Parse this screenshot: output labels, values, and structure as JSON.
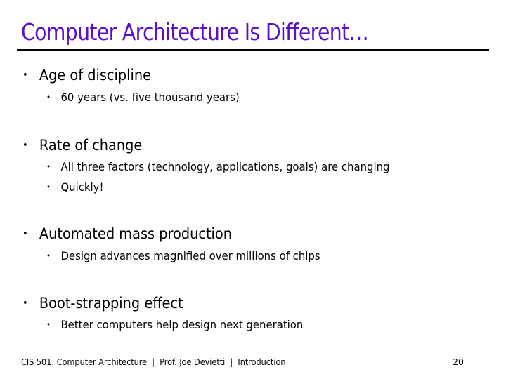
{
  "slide": {
    "title": "Computer Architecture Is Different…",
    "bullets": [
      {
        "text": "Age of discipline",
        "sub": [
          "60 years (vs. five thousand years)"
        ]
      },
      {
        "text": "Rate of change",
        "sub": [
          "All three factors (technology, applications, goals) are changing",
          "Quickly!"
        ]
      },
      {
        "text": "Automated mass production",
        "sub": [
          "Design advances magnified over millions of chips"
        ]
      },
      {
        "text": "Boot-strapping effect",
        "sub": [
          "Better computers help design next generation"
        ]
      }
    ]
  },
  "footer": {
    "text": "CIS 501: Computer Architecture  |  Prof. Joe Devietti  |  Introduction",
    "page_number": "20"
  },
  "bullet_glyph": "•",
  "colors": {
    "title": "#5a10c8"
  }
}
